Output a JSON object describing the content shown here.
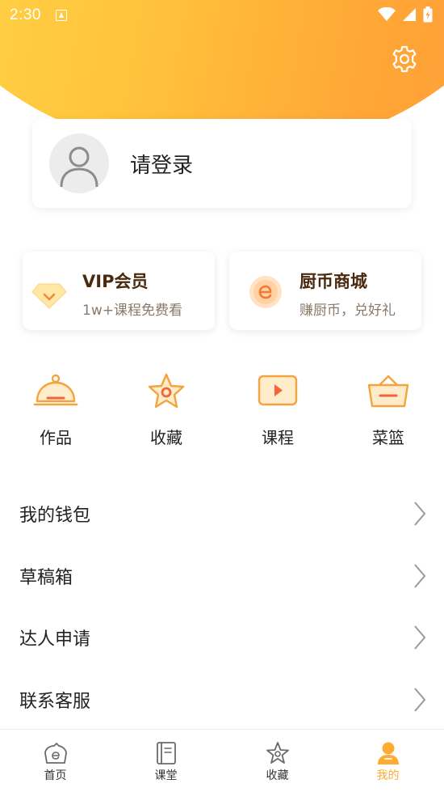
{
  "status_bar": {
    "time": "2:30"
  },
  "login": {
    "label": "请登录"
  },
  "promos": [
    {
      "title": "VIP会员",
      "subtitle": "1w+课程免费看",
      "icon": "diamond-icon"
    },
    {
      "title": "厨币商城",
      "subtitle": "赚厨币，兑好礼",
      "icon": "coin-icon"
    }
  ],
  "quick_actions": [
    {
      "label": "作品",
      "icon": "cloche-icon"
    },
    {
      "label": "收藏",
      "icon": "star-icon"
    },
    {
      "label": "课程",
      "icon": "video-icon"
    },
    {
      "label": "菜篮",
      "icon": "basket-icon"
    }
  ],
  "menu": [
    {
      "label": "我的钱包"
    },
    {
      "label": "草稿箱"
    },
    {
      "label": "达人申请"
    },
    {
      "label": "联系客服"
    }
  ],
  "bottom_nav": [
    {
      "label": "首页",
      "icon": "home-icon",
      "active": false
    },
    {
      "label": "课堂",
      "icon": "book-icon",
      "active": false
    },
    {
      "label": "收藏",
      "icon": "star-icon",
      "active": false
    },
    {
      "label": "我的",
      "icon": "person-icon",
      "active": true
    }
  ],
  "colors": {
    "accent": "#ffab33",
    "gradient_start": "#ffd84a",
    "gradient_end": "#ff9a3a"
  }
}
